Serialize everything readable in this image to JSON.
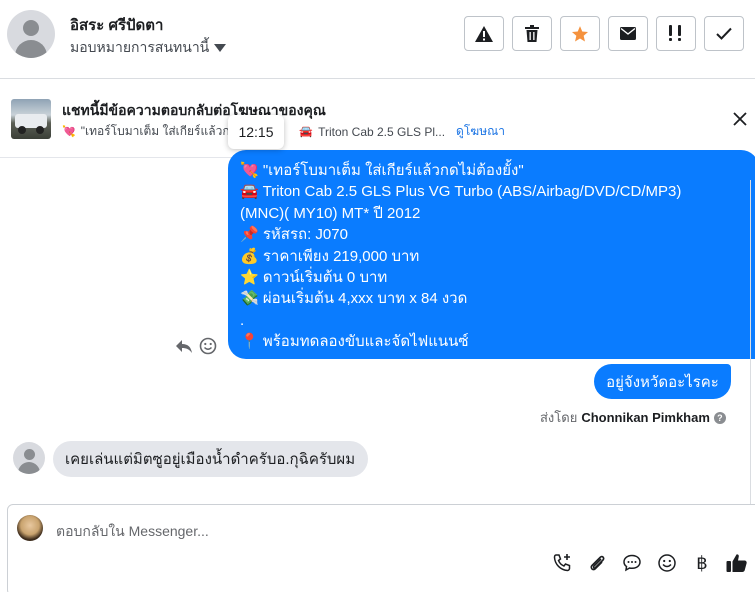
{
  "header": {
    "contact_name": "อิสระ ศรีปัดตา",
    "assign_label": "มอบหมายการสนทนานี้",
    "actions": [
      {
        "icon": "warning-icon"
      },
      {
        "icon": "trash-icon"
      },
      {
        "icon": "star-icon",
        "color": "#f5923e"
      },
      {
        "icon": "mail-icon"
      },
      {
        "icon": "follow-up-icon"
      },
      {
        "icon": "check-icon"
      }
    ]
  },
  "ad_banner": {
    "title": "แชทนี้มีข้อความตอบกลับต่อโฆษณาของคุณ",
    "snippet_part1": "\"เทอร์โบมาเต็ม ใส่เกียร์แล้วกด",
    "snippet_part2": "Triton Cab 2.5 GLS Pl...",
    "view_ad_link": "ดูโฆษณา",
    "tooltip_time": "12:15"
  },
  "messages": {
    "outgoing_ad": [
      {
        "emoji": "💘",
        "text": "\"เทอร์โบมาเต็ม ใส่เกียร์แล้วกดไม่ต้องยั้ง\""
      },
      {
        "emoji": "🚘",
        "text": "Triton Cab 2.5 GLS Plus VG Turbo (ABS/Airbag/DVD/CD/MP3)"
      },
      {
        "emoji": "",
        "text": "(MNC)( MY10) MT* ปี 2012"
      },
      {
        "emoji": "📌",
        "text": "รหัสรถ: J070"
      },
      {
        "emoji": "💰",
        "text": "ราคาเพียง 219,000 บาท"
      },
      {
        "emoji": "⭐",
        "text": "ดาวน์เริ่มต้น 0 บาท"
      },
      {
        "emoji": "💸",
        "text": "ผ่อนเริ่มต้น 4,xxx บาท x 84 งวด"
      },
      {
        "emoji": "",
        "text": "."
      },
      {
        "emoji": "📍",
        "text": "พร้อมทดลองขับและจัดไฟแนนซ์"
      }
    ],
    "outgoing_short": "อยู่จังหวัดอะไรคะ",
    "sent_by_prefix": "ส่งโดย",
    "sent_by_name": "Chonnikan Pimkham",
    "incoming": "เคยเล่นแต่มิตซูอยู่เมืองน้ำดำครับอ.กุฉิครับผม"
  },
  "composer": {
    "placeholder": "ตอบกลับใน Messenger...",
    "tools": [
      "call-add-icon",
      "attach-icon",
      "saved-reply-icon",
      "emoji-icon",
      "baht-icon",
      "thumbs-up-icon"
    ],
    "baht_symbol": "฿"
  },
  "colors": {
    "accent": "#0a7cff",
    "link": "#1b74e4",
    "star": "#f5923e"
  }
}
